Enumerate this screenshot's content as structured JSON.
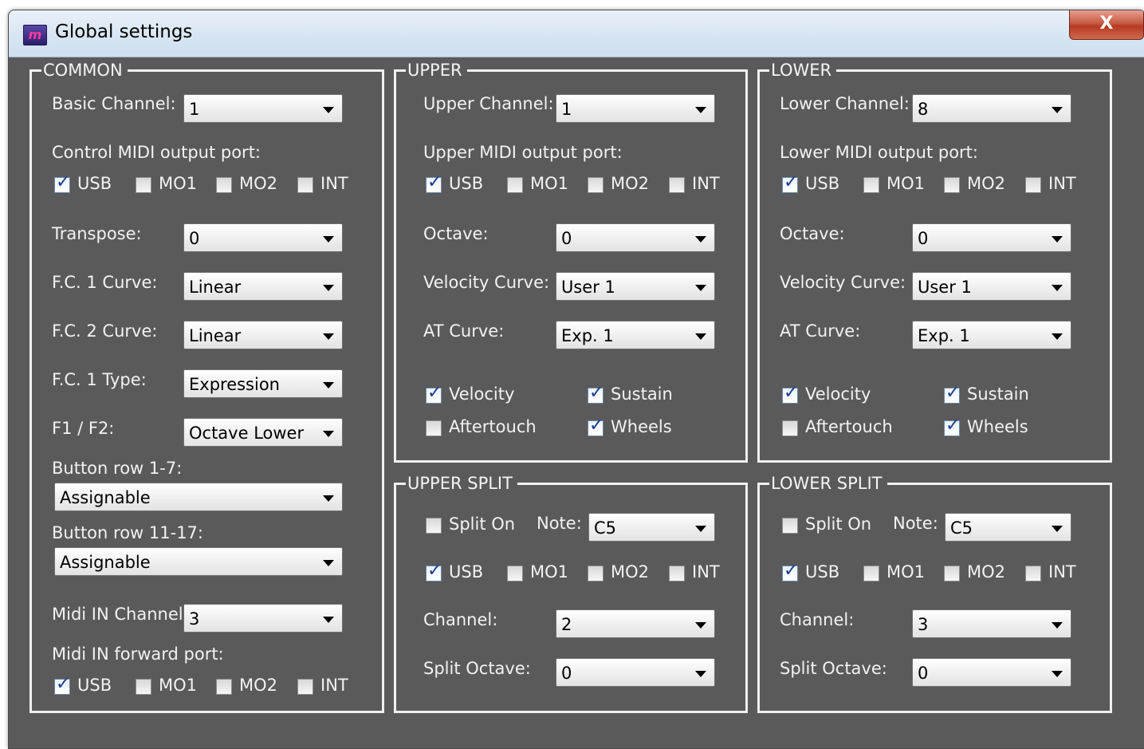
{
  "window": {
    "title": "Global settings",
    "icon": "app-logo-icon",
    "close_label": "X"
  },
  "common": {
    "legend": "COMMON",
    "basic_channel_label": "Basic Channel:",
    "basic_channel_value": "1",
    "control_port_label": "Control MIDI output port:",
    "control_port": [
      {
        "label": "USB",
        "checked": true
      },
      {
        "label": "MO1",
        "checked": false
      },
      {
        "label": "MO2",
        "checked": false
      },
      {
        "label": "INT",
        "checked": false
      }
    ],
    "transpose_label": "Transpose:",
    "transpose_value": "0",
    "fc1_curve_label": "F.C. 1 Curve:",
    "fc1_curve_value": "Linear",
    "fc2_curve_label": "F.C. 2 Curve:",
    "fc2_curve_value": "Linear",
    "fc1_type_label": "F.C. 1 Type:",
    "fc1_type_value": "Expression",
    "f1f2_label": "F1 / F2:",
    "f1f2_value": "Octave Lower",
    "button_row_1_7_label": "Button row 1-7:",
    "button_row_1_7_value": "Assignable",
    "button_row_11_17_label": "Button row 11-17:",
    "button_row_11_17_value": "Assignable",
    "midi_in_channel_label": "Midi IN Channel:",
    "midi_in_channel_value": "3",
    "midi_in_forward_label": "Midi IN forward port:",
    "midi_in_forward": [
      {
        "label": "USB",
        "checked": true
      },
      {
        "label": "MO1",
        "checked": false
      },
      {
        "label": "MO2",
        "checked": false
      },
      {
        "label": "INT",
        "checked": false
      }
    ]
  },
  "upper": {
    "legend": "UPPER",
    "channel_label": "Upper Channel:",
    "channel_value": "1",
    "port_label": "Upper MIDI output port:",
    "port": [
      {
        "label": "USB",
        "checked": true
      },
      {
        "label": "MO1",
        "checked": false
      },
      {
        "label": "MO2",
        "checked": false
      },
      {
        "label": "INT",
        "checked": false
      }
    ],
    "octave_label": "Octave:",
    "octave_value": "0",
    "velocity_curve_label": "Velocity Curve:",
    "velocity_curve_value": "User 1",
    "at_curve_label": "AT Curve:",
    "at_curve_value": "Exp. 1",
    "options": [
      {
        "label": "Velocity",
        "checked": true
      },
      {
        "label": "Sustain",
        "checked": true
      },
      {
        "label": "Aftertouch",
        "checked": false
      },
      {
        "label": "Wheels",
        "checked": true
      }
    ]
  },
  "lower": {
    "legend": "LOWER",
    "channel_label": "Lower Channel:",
    "channel_value": "8",
    "port_label": "Lower MIDI output port:",
    "port": [
      {
        "label": "USB",
        "checked": true
      },
      {
        "label": "MO1",
        "checked": false
      },
      {
        "label": "MO2",
        "checked": false
      },
      {
        "label": "INT",
        "checked": false
      }
    ],
    "octave_label": "Octave:",
    "octave_value": "0",
    "velocity_curve_label": "Velocity Curve:",
    "velocity_curve_value": "User 1",
    "at_curve_label": "AT Curve:",
    "at_curve_value": "Exp. 1",
    "options": [
      {
        "label": "Velocity",
        "checked": true
      },
      {
        "label": "Sustain",
        "checked": true
      },
      {
        "label": "Aftertouch",
        "checked": false
      },
      {
        "label": "Wheels",
        "checked": true
      }
    ]
  },
  "upper_split": {
    "legend": "UPPER SPLIT",
    "split_on": {
      "label": "Split On",
      "checked": false
    },
    "note_label": "Note:",
    "note_value": "C5",
    "port": [
      {
        "label": "USB",
        "checked": true
      },
      {
        "label": "MO1",
        "checked": false
      },
      {
        "label": "MO2",
        "checked": false
      },
      {
        "label": "INT",
        "checked": false
      }
    ],
    "channel_label": "Channel:",
    "channel_value": "2",
    "split_octave_label": "Split Octave:",
    "split_octave_value": "0"
  },
  "lower_split": {
    "legend": "LOWER SPLIT",
    "split_on": {
      "label": "Split On",
      "checked": false
    },
    "note_label": "Note:",
    "note_value": "C5",
    "port": [
      {
        "label": "USB",
        "checked": true
      },
      {
        "label": "MO1",
        "checked": false
      },
      {
        "label": "MO2",
        "checked": false
      },
      {
        "label": "INT",
        "checked": false
      }
    ],
    "channel_label": "Channel:",
    "channel_value": "3",
    "split_octave_label": "Split Octave:",
    "split_octave_value": "0"
  },
  "colors": {
    "background": "#5a5a5a",
    "frame": "#f0f0f0",
    "check": "#1a3d8f",
    "close": "#c75a43"
  }
}
